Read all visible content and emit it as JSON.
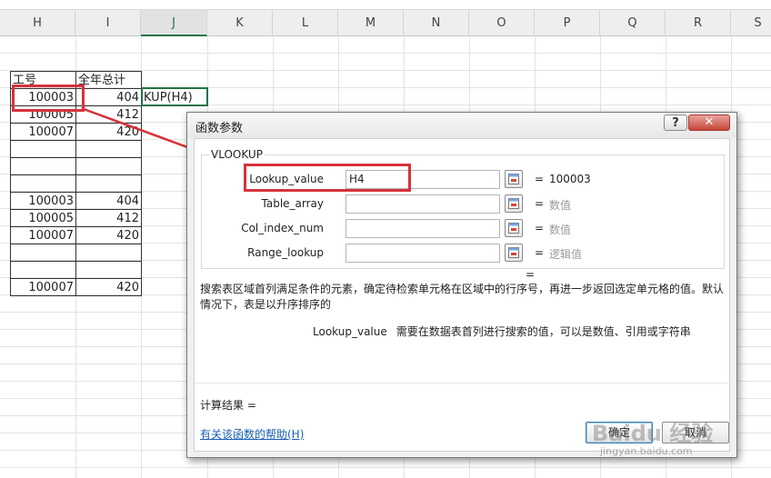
{
  "sheet": {
    "columns": [
      "H",
      "I",
      "J",
      "K",
      "L",
      "M",
      "N",
      "O",
      "P",
      "Q",
      "R",
      "S"
    ],
    "active_column": "J",
    "headers": {
      "h": "工号",
      "i": "全年总计"
    },
    "rows": [
      {
        "h": "100003",
        "i": "404"
      },
      {
        "h": "100005",
        "i": "412"
      },
      {
        "h": "100007",
        "i": "420"
      },
      {
        "h": "",
        "i": ""
      },
      {
        "h": "",
        "i": ""
      },
      {
        "h": "",
        "i": ""
      },
      {
        "h": "100003",
        "i": "404"
      },
      {
        "h": "100005",
        "i": "412"
      },
      {
        "h": "100007",
        "i": "420"
      },
      {
        "h": "",
        "i": ""
      },
      {
        "h": "",
        "i": ""
      },
      {
        "h": "100007",
        "i": "420"
      }
    ],
    "formula_cell_text": "KUP(H4)"
  },
  "dialog": {
    "title": "函数参数",
    "help_button": "?",
    "close_button": "✕",
    "function_name": "VLOOKUP",
    "args": [
      {
        "label": "Lookup_value",
        "value": "H4",
        "result": "100003",
        "dim": false
      },
      {
        "label": "Table_array",
        "value": "",
        "result": "数值",
        "dim": true
      },
      {
        "label": "Col_index_num",
        "value": "",
        "result": "数值",
        "dim": true
      },
      {
        "label": "Range_lookup",
        "value": "",
        "result": "逻辑值",
        "dim": true
      }
    ],
    "equals": "=",
    "result_equals": "=",
    "description": "搜索表区域首列满足条件的元素，确定待检索单元格在区域中的行序号，再进一步返回选定单元格的值。默认情况下，表是以升序排序的",
    "arg_description_name": "Lookup_value",
    "arg_description": "需要在数据表首列进行搜索的值，可以是数值、引用或字符串",
    "calc_result_label": "计算结果 =",
    "help_link": "有关该函数的帮助(H)",
    "ok_label": "确定",
    "cancel_label": "取消"
  },
  "annotation_color": "#d7323c",
  "watermark": {
    "logo": "Baidu 经验",
    "url": "jingyan.baidu.com"
  }
}
